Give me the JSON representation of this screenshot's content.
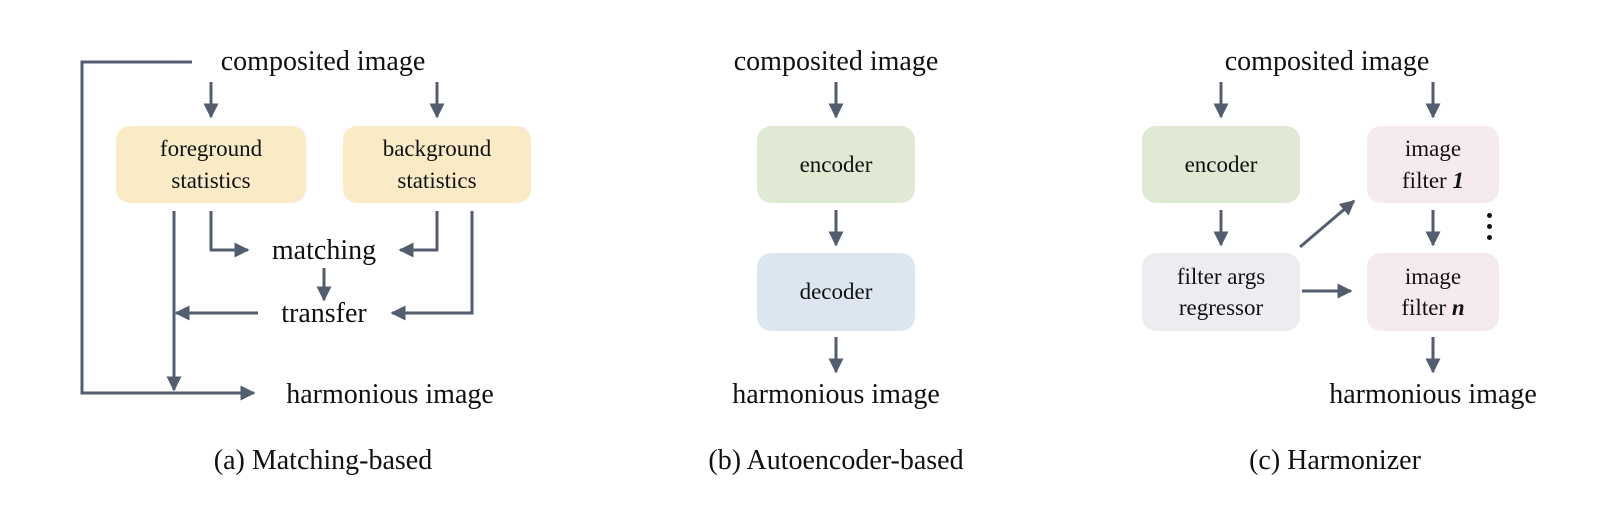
{
  "colors": {
    "arrow": "#535d6e",
    "stats_box": "#faebc7",
    "encoder_box": "#dfe9d3",
    "decoder_box": "#dbe6f0",
    "regressor_box": "#eeecf0",
    "filter_box": "#f5eaec"
  },
  "panel_a": {
    "input": "composited image",
    "foreground_stats": [
      "foreground",
      "statistics"
    ],
    "background_stats": [
      "background",
      "statistics"
    ],
    "matching": "matching",
    "transfer": "transfer",
    "output": "harmonious image",
    "caption": "(a) Matching-based"
  },
  "panel_b": {
    "input": "composited image",
    "encoder": "encoder",
    "decoder": "decoder",
    "output": "harmonious image",
    "caption": "(b) Autoencoder-based"
  },
  "panel_c": {
    "input": "composited image",
    "encoder": "encoder",
    "regressor": [
      "filter args",
      "regressor"
    ],
    "filter_first": {
      "line1": "image",
      "line2": "filter ",
      "index": "1"
    },
    "filter_last": {
      "line1": "image",
      "line2": "filter ",
      "index": "n"
    },
    "output": "harmonious image",
    "caption": "(c) Harmonizer"
  }
}
